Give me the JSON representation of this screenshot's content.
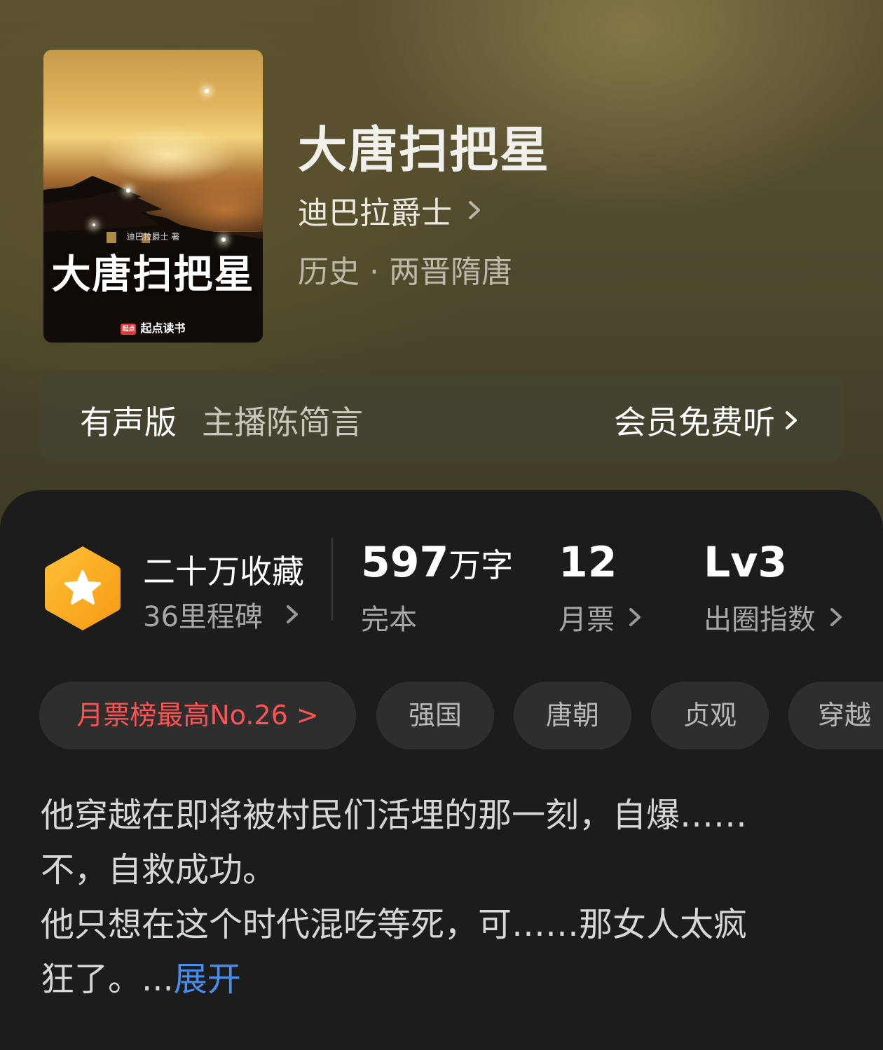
{
  "book": {
    "title": "大唐扫把星",
    "author": "迪巴拉爵士",
    "genre": "历史 · 两晋隋唐"
  },
  "cover": {
    "title": "大唐扫把星",
    "author_credit": "迪巴拉爵士 著",
    "publisher": "起点读书",
    "publisher_mark": "起点"
  },
  "audio": {
    "label": "有声版",
    "host": "主播陈简言",
    "cta": "会员免费听"
  },
  "stats": {
    "favorites": "二十万收藏",
    "milestone": "36里程碑",
    "words_num": "597",
    "words_unit": "万字",
    "status": "完本",
    "monthly_votes": "12",
    "monthly_label": "月票",
    "level": "Lv3",
    "level_label": "出圈指数"
  },
  "tags": {
    "rank": "月票榜最高No.26 >",
    "items": [
      "强国",
      "唐朝",
      "贞观",
      "穿越"
    ]
  },
  "description": {
    "line1": "他穿越在即将被村民们活埋的那一刻，自爆……",
    "line2": "不，自救成功。",
    "line3": "他只想在这个时代混吃等死，可……那女人太疯",
    "line4": "狂了。...",
    "expand": "展开"
  },
  "colors": {
    "accent_blue": "#4a8de8",
    "rank_red": "#ff5353",
    "badge_orange": "#f7a51c"
  }
}
